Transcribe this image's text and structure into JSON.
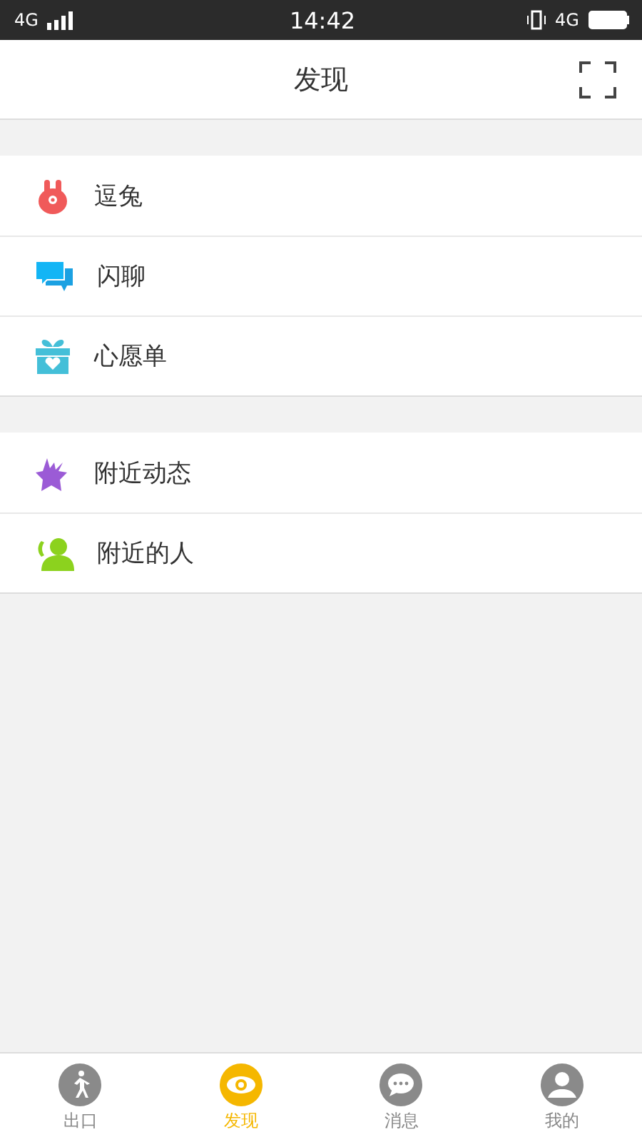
{
  "status_bar": {
    "network": "4G",
    "time": "14:42",
    "network_right": "4G"
  },
  "header": {
    "title": "发现"
  },
  "groups": [
    [
      {
        "kind": "rabbit",
        "label": "逗兔"
      },
      {
        "kind": "chat",
        "label": "闪聊"
      },
      {
        "kind": "gift",
        "label": "心愿单"
      }
    ],
    [
      {
        "kind": "star",
        "label": "附近动态"
      },
      {
        "kind": "people",
        "label": "附近的人"
      }
    ]
  ],
  "tabs": [
    {
      "kind": "walk",
      "label": "出口",
      "selected": false
    },
    {
      "kind": "eye",
      "label": "发现",
      "selected": true
    },
    {
      "kind": "message",
      "label": "消息",
      "selected": false
    },
    {
      "kind": "user",
      "label": "我的",
      "selected": false
    }
  ]
}
